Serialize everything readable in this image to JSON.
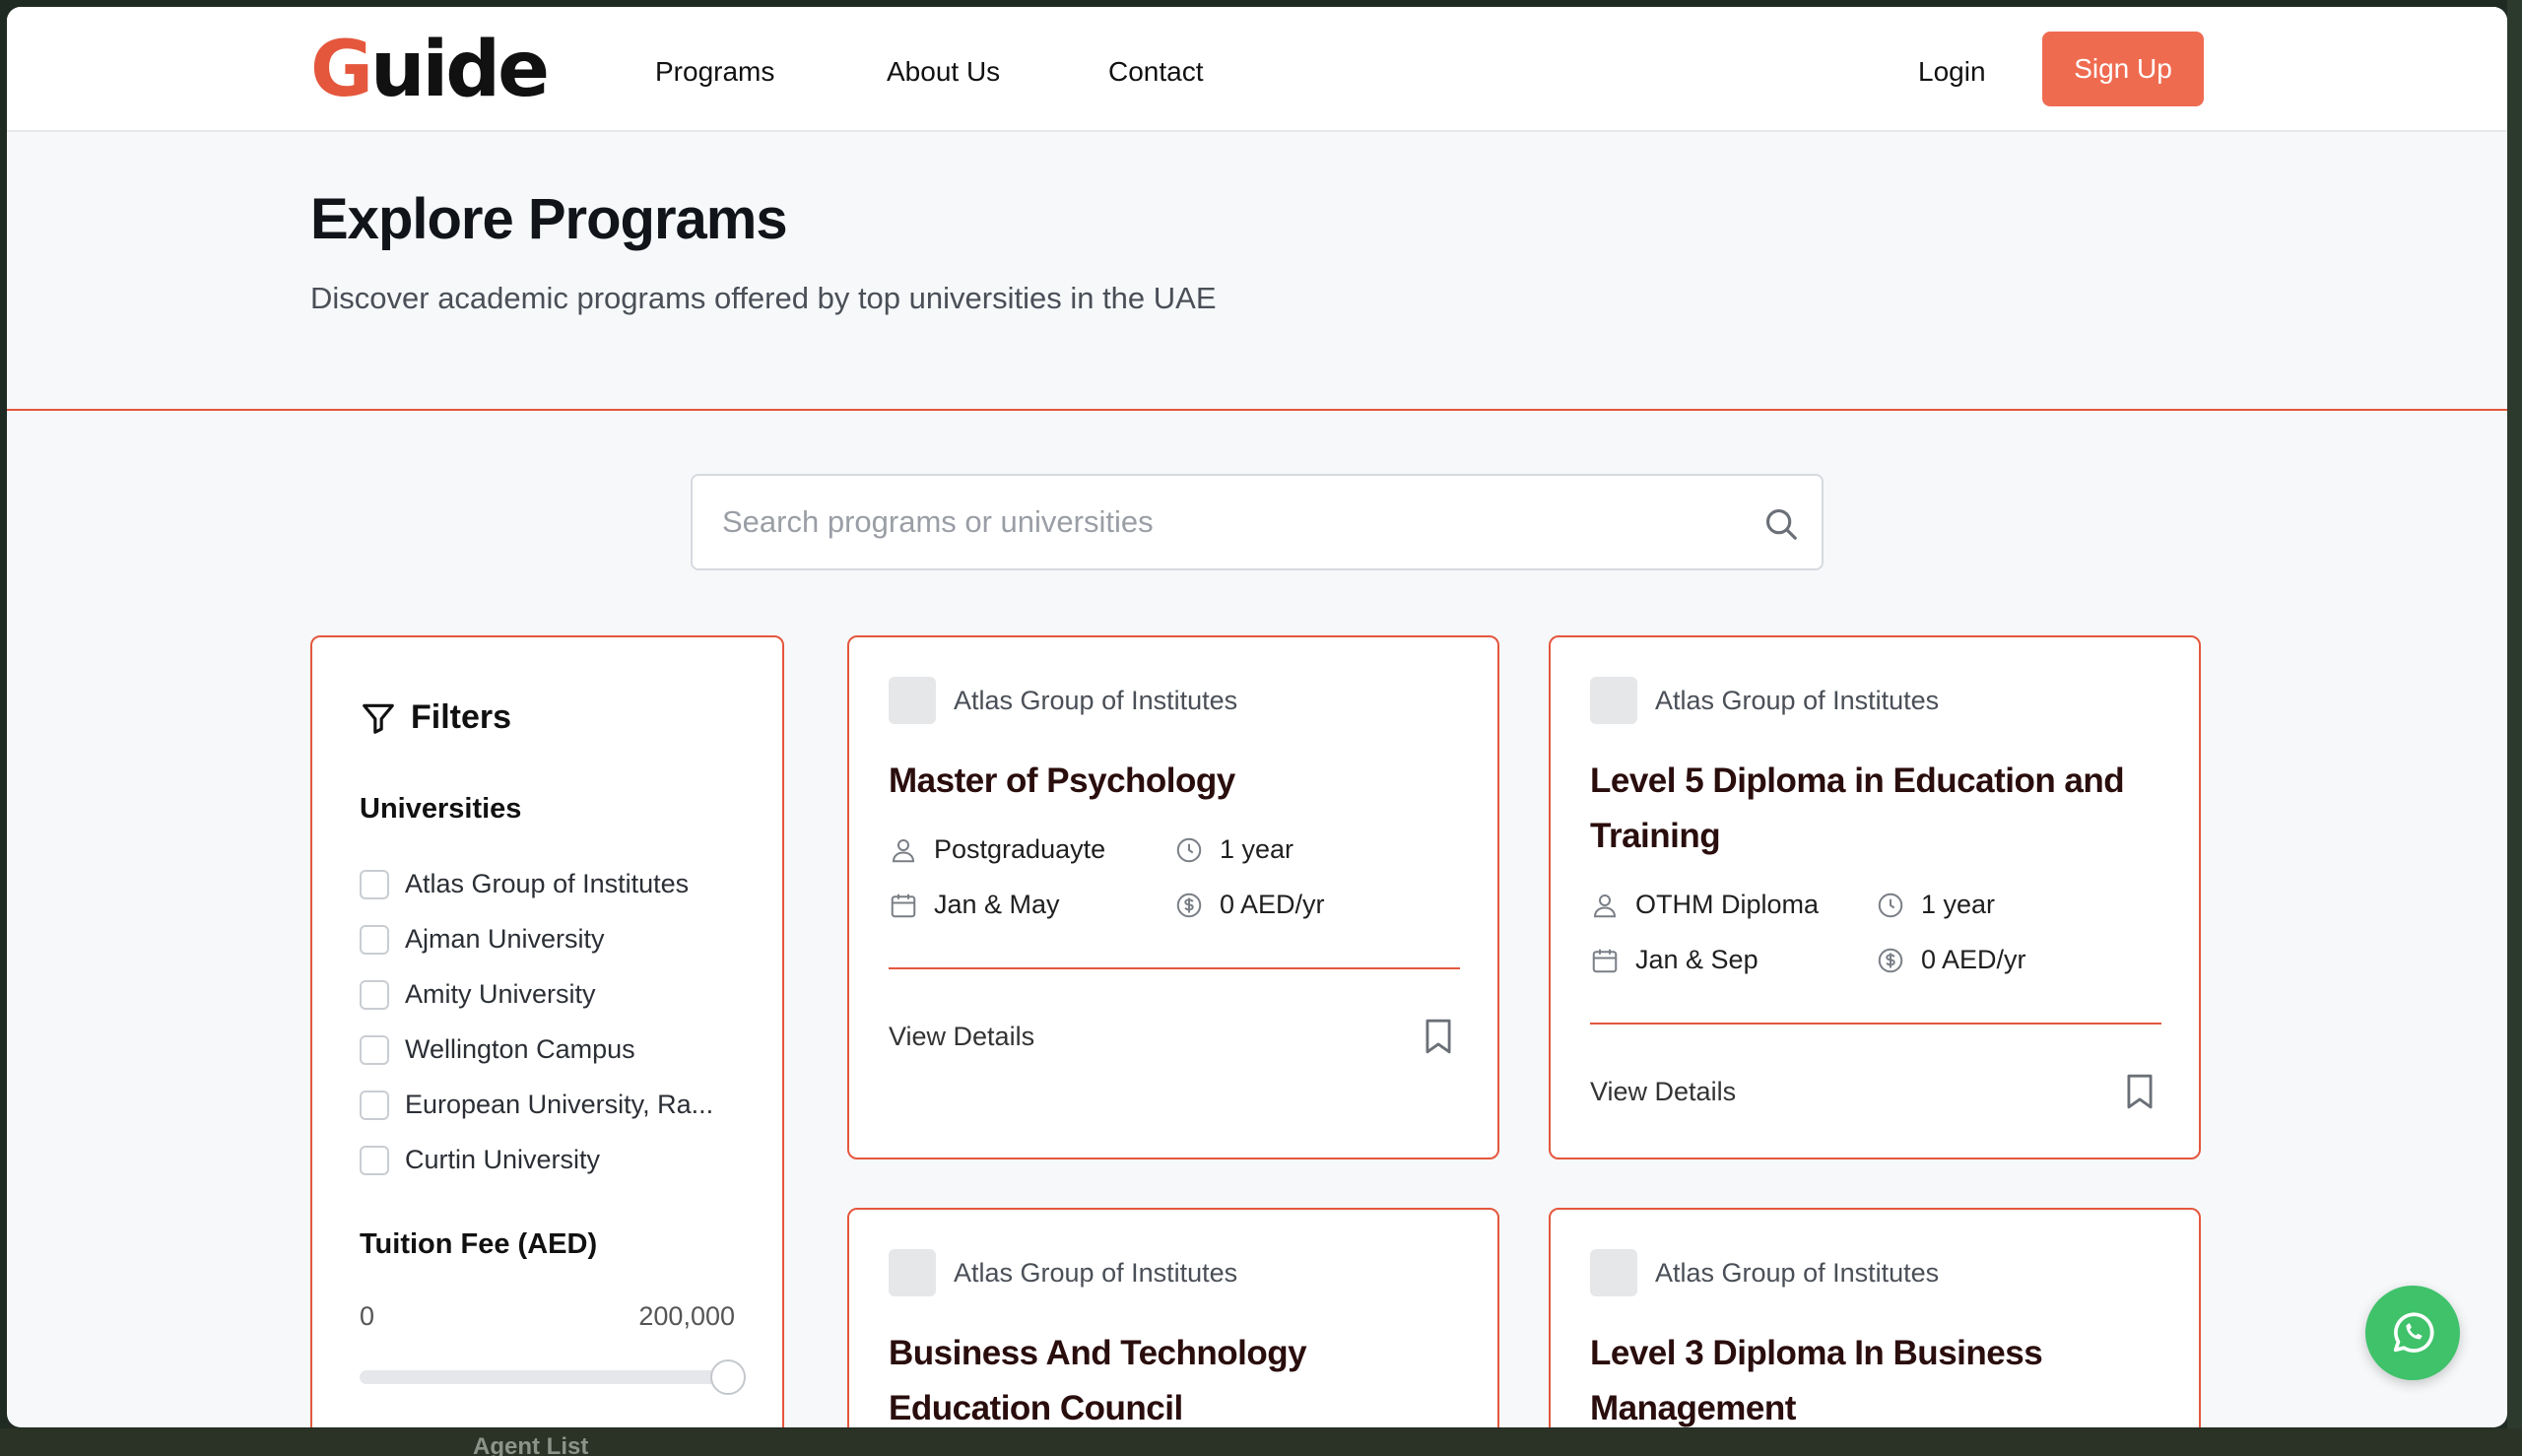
{
  "brand": {
    "logo_text": "Guide",
    "accent_color": "#e4573d",
    "button_color": "#ef6b50"
  },
  "nav": {
    "items": [
      "Programs",
      "About Us",
      "Contact"
    ],
    "login": "Login",
    "signup": "Sign Up"
  },
  "hero": {
    "title": "Explore Programs",
    "subtitle": "Discover academic programs offered by top universities in the UAE"
  },
  "search": {
    "placeholder": "Search programs or universities",
    "icon": "search-icon"
  },
  "filters": {
    "title": "Filters",
    "universities_title": "Universities",
    "universities": [
      "Atlas Group of Institutes",
      "Ajman University",
      "Amity University",
      "Wellington Campus",
      "European University, Ra...",
      "Curtin University"
    ],
    "tuition_title": "Tuition Fee (AED)",
    "tuition_min": "0",
    "tuition_max": "200,000",
    "tuition_slider_value_fraction": 1.0
  },
  "programs": [
    {
      "university": "Atlas Group of Institutes",
      "title": "Master of Psychology",
      "level": "Postgraduayte",
      "duration": "1 year",
      "intake": "Jan & May",
      "fee": "0 AED/yr",
      "action": "View Details"
    },
    {
      "university": "Atlas Group of Institutes",
      "title": "Level 5 Diploma in Education and Training",
      "level": "OTHM Diploma",
      "duration": "1 year",
      "intake": "Jan & Sep",
      "fee": "0 AED/yr",
      "action": "View Details"
    },
    {
      "university": "Atlas Group of Institutes",
      "title": "Business And Technology Education Council"
    },
    {
      "university": "Atlas Group of Institutes",
      "title": "Level 3 Diploma In Business Management"
    }
  ],
  "background_peek_text": "Agent List",
  "whatsapp": {
    "icon": "whatsapp-icon",
    "color": "#3fc26a"
  }
}
